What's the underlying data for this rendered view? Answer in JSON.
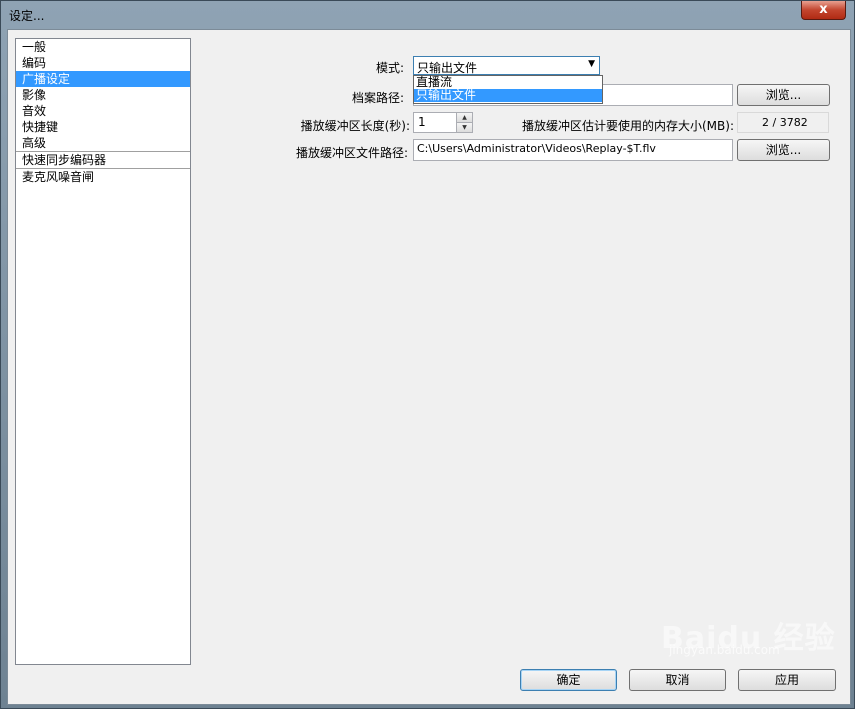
{
  "window": {
    "title": "设定...",
    "close_label": "x"
  },
  "nav": {
    "items": [
      {
        "label": "一般",
        "selected": false
      },
      {
        "label": "编码",
        "selected": false
      },
      {
        "label": "广播设定",
        "selected": true
      },
      {
        "label": "影像",
        "selected": false
      },
      {
        "label": "音效",
        "selected": false
      },
      {
        "label": "快捷键",
        "selected": false
      },
      {
        "label": "高级",
        "selected": false
      },
      {
        "label": "快速同步编码器",
        "selected": false
      },
      {
        "label": "麦克风噪音闸",
        "selected": false
      }
    ]
  },
  "broadcast": {
    "mode_label": "模式:",
    "mode_value": "只输出文件",
    "mode_options": [
      "直播流",
      "只输出文件"
    ],
    "file_path_label": "档案路径:",
    "file_path_value": "",
    "browse_label": "浏览...",
    "buffer_length_label": "播放缓冲区长度(秒):",
    "buffer_length_value": "1",
    "memory_label": "播放缓冲区估计要使用的内存大小(MB):",
    "memory_value": "2 / 3782",
    "buffer_path_label": "播放缓冲区文件路径:",
    "buffer_path_value": "C:\\Users\\Administrator\\Videos\\Replay-$T.flv",
    "browse2_label": "浏览..."
  },
  "footer": {
    "ok_label": "确定",
    "cancel_label": "取消",
    "apply_label": "应用"
  },
  "watermark": {
    "text": "Baidu 经验",
    "sub": "jingyan.baidu.com"
  }
}
